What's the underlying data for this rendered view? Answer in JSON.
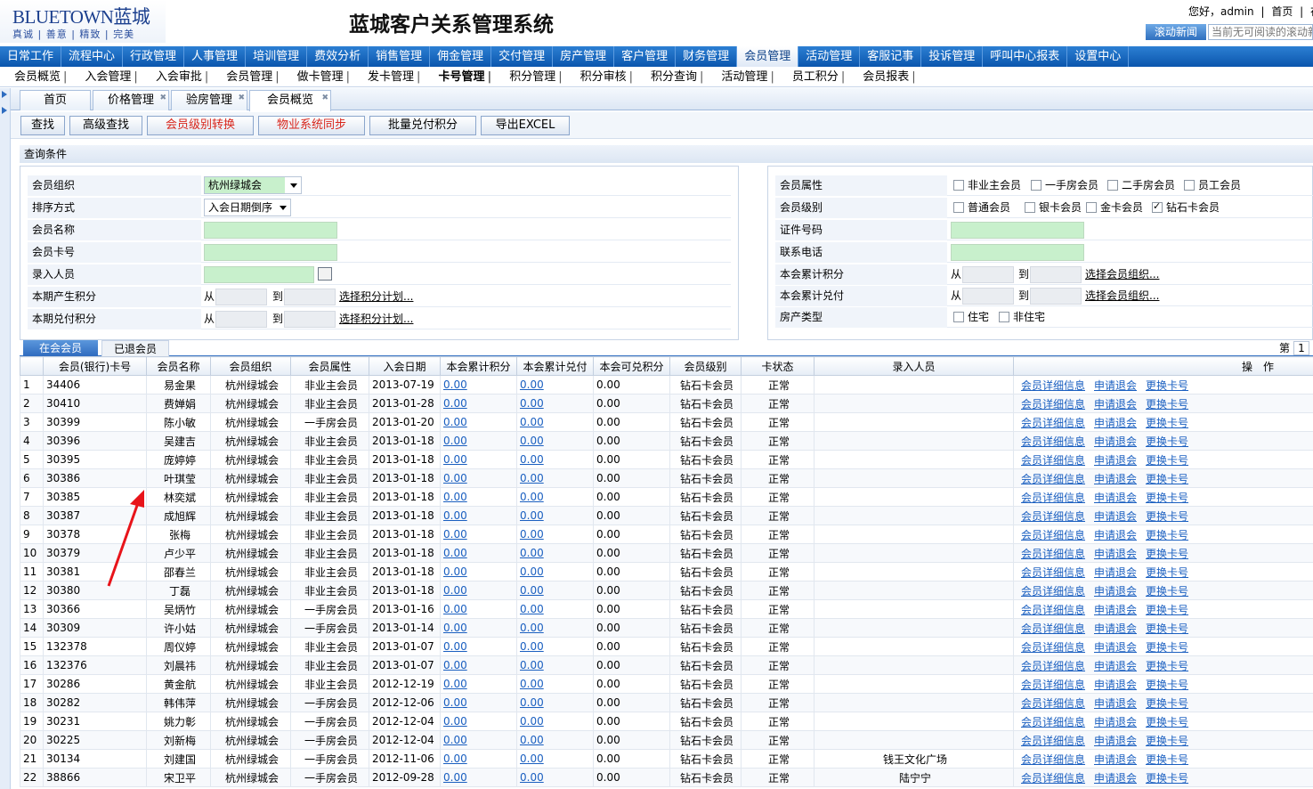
{
  "header": {
    "logo_main": "BLUETOWN蓝城",
    "logo_tagline": "真诚 | 善意 | 精致 | 完美",
    "system_title": "蓝城客户关系管理系统",
    "greeting": "您好，admin",
    "home_link": "首页",
    "extra_link": "在线",
    "news_button": "滚动新闻",
    "news_text": "当前无可阅读的滚动新闻"
  },
  "main_nav": [
    "日常工作",
    "流程中心",
    "行政管理",
    "人事管理",
    "培训管理",
    "费效分析",
    "销售管理",
    "佣金管理",
    "交付管理",
    "房产管理",
    "客户管理",
    "财务管理",
    "会员管理",
    "活动管理",
    "客服记事",
    "投诉管理",
    "呼叫中心报表",
    "设置中心"
  ],
  "main_nav_active": "会员管理",
  "sub_nav": [
    "会员概览",
    "入会管理",
    "入会审批",
    "会员管理",
    "做卡管理",
    "发卡管理",
    "卡号管理",
    "积分管理",
    "积分审核",
    "积分查询",
    "活动管理",
    "员工积分",
    "会员报表"
  ],
  "sub_nav_bold": "卡号管理",
  "page_tabs": [
    "首页",
    "价格管理",
    "验房管理",
    "会员概览"
  ],
  "page_tab_active": "会员概览",
  "toolbar": {
    "search": "查找",
    "advanced_search": "高级查找",
    "level_convert": "会员级别转换",
    "property_sync": "物业系统同步",
    "batch_redeem": "批量兑付积分",
    "export_excel": "导出EXCEL"
  },
  "query": {
    "title": "查询条件",
    "left": {
      "org_label": "会员组织",
      "org_value": "杭州绿城会",
      "sort_label": "排序方式",
      "sort_value": "入会日期倒序",
      "name_label": "会员名称",
      "card_label": "会员卡号",
      "entry_label": "录入人员",
      "period_points_label": "本期产生积分",
      "period_redeem_label": "本期兑付积分",
      "from": "从",
      "to": "到",
      "select_plan": "选择积分计划..."
    },
    "right": {
      "attr_label": "会员属性",
      "attr_options": [
        "非业主会员",
        "一手房会员",
        "二手房会员",
        "员工会员"
      ],
      "level_label": "会员级别",
      "level_options": [
        "普通会员",
        "银卡会员",
        "金卡会员",
        "钻石卡会员"
      ],
      "level_checked": "钻石卡会员",
      "id_label": "证件号码",
      "phone_label": "联系电话",
      "total_points_label": "本会累计积分",
      "total_redeem_label": "本会累计兑付",
      "from": "从",
      "to": "到",
      "select_org": "选择会员组织...",
      "property_type_label": "房产类型",
      "property_options": [
        "住宅",
        "非住宅"
      ]
    }
  },
  "member_tabs": [
    "在会会员",
    "已退会员"
  ],
  "member_tab_active": "在会会员",
  "pager": {
    "label": "第",
    "page": "1"
  },
  "table": {
    "columns": [
      "",
      "会员(银行)卡号",
      "会员名称",
      "会员组织",
      "会员属性",
      "入会日期",
      "本会累计积分",
      "本会累计兑付",
      "本会可兑积分",
      "会员级别",
      "卡状态",
      "录入人员",
      "操　作"
    ],
    "op_links": [
      "会员详细信息",
      "申请退会",
      "更换卡号"
    ],
    "rows": [
      [
        "1",
        "34406",
        "易金果",
        "杭州绿城会",
        "非业主会员",
        "2013-07-19",
        "0.00",
        "0.00",
        "0.00",
        "钻石卡会员",
        "正常",
        ""
      ],
      [
        "2",
        "30410",
        "费婵娟",
        "杭州绿城会",
        "非业主会员",
        "2013-01-28",
        "0.00",
        "0.00",
        "0.00",
        "钻石卡会员",
        "正常",
        ""
      ],
      [
        "3",
        "30399",
        "陈小敏",
        "杭州绿城会",
        "一手房会员",
        "2013-01-20",
        "0.00",
        "0.00",
        "0.00",
        "钻石卡会员",
        "正常",
        ""
      ],
      [
        "4",
        "30396",
        "吴建吉",
        "杭州绿城会",
        "非业主会员",
        "2013-01-18",
        "0.00",
        "0.00",
        "0.00",
        "钻石卡会员",
        "正常",
        ""
      ],
      [
        "5",
        "30395",
        "庞婷婷",
        "杭州绿城会",
        "非业主会员",
        "2013-01-18",
        "0.00",
        "0.00",
        "0.00",
        "钻石卡会员",
        "正常",
        ""
      ],
      [
        "6",
        "30386",
        "叶琪莹",
        "杭州绿城会",
        "非业主会员",
        "2013-01-18",
        "0.00",
        "0.00",
        "0.00",
        "钻石卡会员",
        "正常",
        ""
      ],
      [
        "7",
        "30385",
        "林奕斌",
        "杭州绿城会",
        "非业主会员",
        "2013-01-18",
        "0.00",
        "0.00",
        "0.00",
        "钻石卡会员",
        "正常",
        ""
      ],
      [
        "8",
        "30387",
        "成旭辉",
        "杭州绿城会",
        "非业主会员",
        "2013-01-18",
        "0.00",
        "0.00",
        "0.00",
        "钻石卡会员",
        "正常",
        ""
      ],
      [
        "9",
        "30378",
        "张梅",
        "杭州绿城会",
        "非业主会员",
        "2013-01-18",
        "0.00",
        "0.00",
        "0.00",
        "钻石卡会员",
        "正常",
        ""
      ],
      [
        "10",
        "30379",
        "卢少平",
        "杭州绿城会",
        "非业主会员",
        "2013-01-18",
        "0.00",
        "0.00",
        "0.00",
        "钻石卡会员",
        "正常",
        ""
      ],
      [
        "11",
        "30381",
        "邵春兰",
        "杭州绿城会",
        "非业主会员",
        "2013-01-18",
        "0.00",
        "0.00",
        "0.00",
        "钻石卡会员",
        "正常",
        ""
      ],
      [
        "12",
        "30380",
        "丁磊",
        "杭州绿城会",
        "非业主会员",
        "2013-01-18",
        "0.00",
        "0.00",
        "0.00",
        "钻石卡会员",
        "正常",
        ""
      ],
      [
        "13",
        "30366",
        "吴炳竹",
        "杭州绿城会",
        "一手房会员",
        "2013-01-16",
        "0.00",
        "0.00",
        "0.00",
        "钻石卡会员",
        "正常",
        ""
      ],
      [
        "14",
        "30309",
        "许小姑",
        "杭州绿城会",
        "一手房会员",
        "2013-01-14",
        "0.00",
        "0.00",
        "0.00",
        "钻石卡会员",
        "正常",
        ""
      ],
      [
        "15",
        "132378",
        "周仪婷",
        "杭州绿城会",
        "非业主会员",
        "2013-01-07",
        "0.00",
        "0.00",
        "0.00",
        "钻石卡会员",
        "正常",
        ""
      ],
      [
        "16",
        "132376",
        "刘晨祎",
        "杭州绿城会",
        "非业主会员",
        "2013-01-07",
        "0.00",
        "0.00",
        "0.00",
        "钻石卡会员",
        "正常",
        ""
      ],
      [
        "17",
        "30286",
        "黄金航",
        "杭州绿城会",
        "非业主会员",
        "2012-12-19",
        "0.00",
        "0.00",
        "0.00",
        "钻石卡会员",
        "正常",
        ""
      ],
      [
        "18",
        "30282",
        "韩伟萍",
        "杭州绿城会",
        "一手房会员",
        "2012-12-06",
        "0.00",
        "0.00",
        "0.00",
        "钻石卡会员",
        "正常",
        ""
      ],
      [
        "19",
        "30231",
        "姚力彰",
        "杭州绿城会",
        "一手房会员",
        "2012-12-04",
        "0.00",
        "0.00",
        "0.00",
        "钻石卡会员",
        "正常",
        ""
      ],
      [
        "20",
        "30225",
        "刘新梅",
        "杭州绿城会",
        "一手房会员",
        "2012-12-04",
        "0.00",
        "0.00",
        "0.00",
        "钻石卡会员",
        "正常",
        ""
      ],
      [
        "21",
        "30134",
        "刘建国",
        "杭州绿城会",
        "一手房会员",
        "2012-11-06",
        "0.00",
        "0.00",
        "0.00",
        "钻石卡会员",
        "正常",
        "钱王文化广场"
      ],
      [
        "22",
        "38866",
        "宋卫平",
        "杭州绿城会",
        "一手房会员",
        "2012-09-28",
        "0.00",
        "0.00",
        "0.00",
        "钻石卡会员",
        "正常",
        "陆宁宁"
      ]
    ]
  },
  "colors": {
    "nav_blue": "#0b56ad",
    "link_blue": "#1a5fc0",
    "input_green": "#c8f0cc",
    "alert_red": "#d8261c",
    "annotation_red": "#e8141a"
  }
}
